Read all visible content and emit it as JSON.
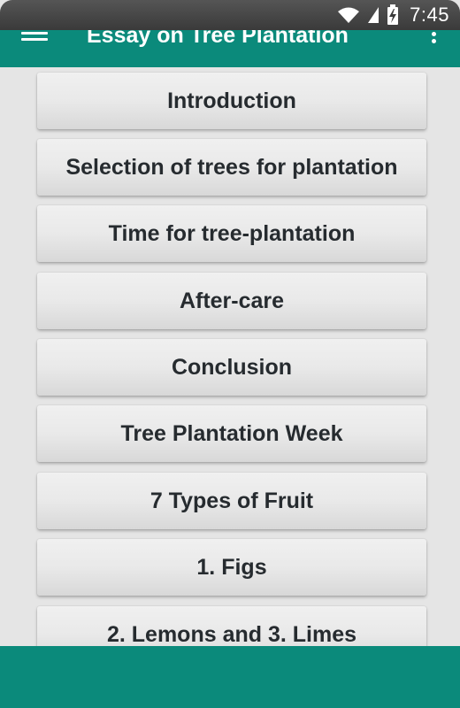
{
  "status_bar": {
    "time": "7:45",
    "icons": [
      "wifi-icon",
      "signal-icon",
      "battery-charging-icon"
    ]
  },
  "app_bar": {
    "title": "Essay on Tree Plantation",
    "menu_icon": "hamburger-menu-icon",
    "overflow_icon": "more-vertical-icon",
    "color": "#0b8a7b"
  },
  "items": [
    {
      "label": "Introduction"
    },
    {
      "label": "Selection of trees for plantation"
    },
    {
      "label": "Time for tree-plantation"
    },
    {
      "label": "After-care"
    },
    {
      "label": "Conclusion"
    },
    {
      "label": "Tree Plantation Week"
    },
    {
      "label": "7 Types of Fruit"
    },
    {
      "label": "1. Figs"
    },
    {
      "label": "2. Lemons and 3. Limes"
    }
  ],
  "colors": {
    "accent": "#0b8a7b",
    "button_text": "#262b2f",
    "background": "#e5e5e5"
  }
}
